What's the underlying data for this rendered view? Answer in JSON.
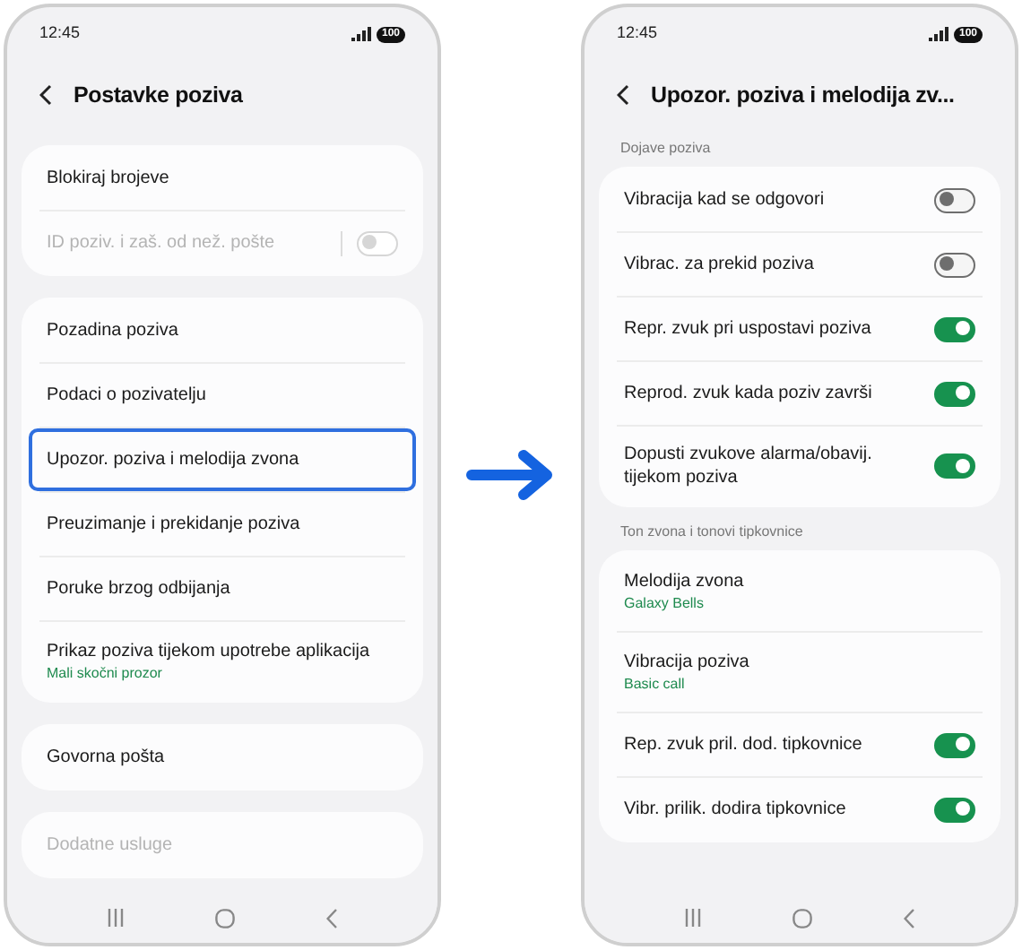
{
  "phones": [
    {
      "status_bar": {
        "time": "12:45",
        "battery": "100"
      },
      "title": "Postavke poziva",
      "sections": [
        {
          "items": [
            {
              "label": "Blokiraj brojeve",
              "kind": "link",
              "disabled": false,
              "selected": false
            },
            {
              "label": "ID poziv. i zaš. od než. pošte",
              "kind": "toggle",
              "on": false,
              "disabled": true,
              "selected": false
            }
          ]
        },
        {
          "items": [
            {
              "label": "Pozadina poziva",
              "kind": "link",
              "disabled": false,
              "selected": false
            },
            {
              "label": "Podaci o pozivatelju",
              "kind": "link",
              "disabled": false,
              "selected": false
            },
            {
              "label": "Upozor. poziva i melodija zvona",
              "kind": "link",
              "disabled": false,
              "selected": true
            },
            {
              "label": "Preuzimanje i prekidanje poziva",
              "kind": "link",
              "disabled": false,
              "selected": false
            },
            {
              "label": "Poruke brzog odbijanja",
              "kind": "link",
              "disabled": false,
              "selected": false
            },
            {
              "label": "Prikaz poziva tijekom upotrebe aplikacija",
              "sublabel": "Mali skočni prozor",
              "kind": "link",
              "disabled": false,
              "selected": false
            }
          ]
        },
        {
          "items": [
            {
              "label": "Govorna pošta",
              "kind": "link",
              "disabled": false,
              "selected": false
            }
          ]
        },
        {
          "items": [
            {
              "label": "Dodatne usluge",
              "kind": "link",
              "disabled": true,
              "selected": false
            }
          ]
        }
      ]
    },
    {
      "status_bar": {
        "time": "12:45",
        "battery": "100"
      },
      "title": "Upozor. poziva i melodija zv...",
      "sections": [
        {
          "heading": "Dojave poziva",
          "items": [
            {
              "label": "Vibracija kad se odgovori",
              "kind": "toggle",
              "on": false,
              "disabled": false,
              "selected": false
            },
            {
              "label": "Vibrac. za prekid poziva",
              "kind": "toggle",
              "on": false,
              "disabled": false,
              "selected": false
            },
            {
              "label": "Repr. zvuk pri uspostavi poziva",
              "kind": "toggle",
              "on": true,
              "disabled": false,
              "selected": false
            },
            {
              "label": "Reprod. zvuk kada poziv završi",
              "kind": "toggle",
              "on": true,
              "disabled": false,
              "selected": false
            },
            {
              "label": "Dopusti zvukove alarma/obavij. tijekom poziva",
              "kind": "toggle",
              "on": true,
              "disabled": false,
              "selected": false
            }
          ]
        },
        {
          "heading": "Ton zvona i tonovi tipkovnice",
          "items": [
            {
              "label": "Melodija zvona",
              "sublabel": "Galaxy Bells",
              "kind": "link",
              "disabled": false,
              "selected": false
            },
            {
              "label": "Vibracija poziva",
              "sublabel": "Basic call",
              "kind": "link",
              "disabled": false,
              "selected": false
            },
            {
              "label": "Rep. zvuk pril. dod. tipkovnice",
              "kind": "toggle",
              "on": true,
              "disabled": false,
              "selected": false
            },
            {
              "label": "Vibr. prilik. dodira tipkovnice",
              "kind": "toggle",
              "on": true,
              "disabled": false,
              "selected": false
            }
          ]
        }
      ]
    }
  ]
}
